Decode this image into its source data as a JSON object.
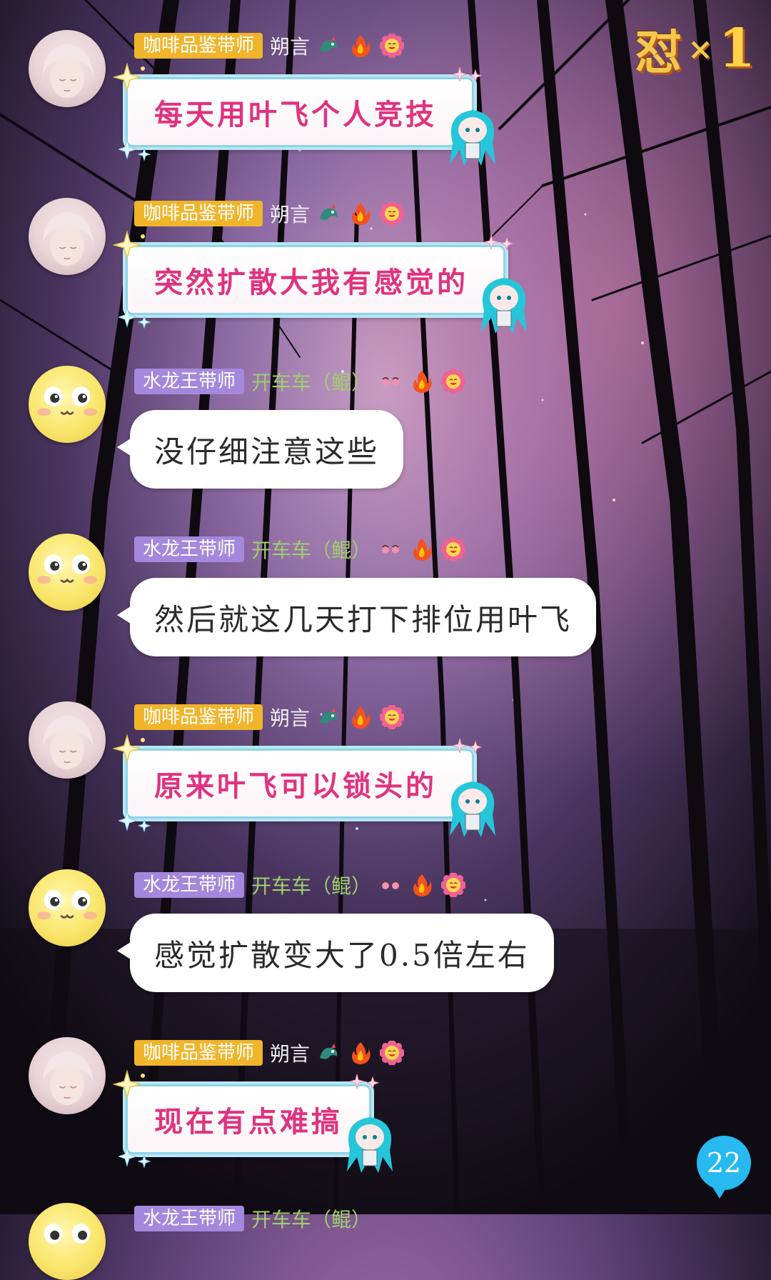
{
  "corner_badge": {
    "char": "怼",
    "times": "×",
    "count": "1"
  },
  "unread_count": "22",
  "messages": [
    {
      "title": "咖啡品鉴带师",
      "nickname": "朔言",
      "text": "每天用叶飞个人竞技",
      "style": "fancy"
    },
    {
      "title": "咖啡品鉴带师",
      "nickname": "朔言",
      "text": "突然扩散大我有感觉的",
      "style": "fancy"
    },
    {
      "title": "水龙王带师",
      "nickname": "开车车（鲲）",
      "text": "没仔细注意这些",
      "style": "plain"
    },
    {
      "title": "水龙王带师",
      "nickname": "开车车（鲲）",
      "text": "然后就这几天打下排位用叶飞",
      "style": "plain"
    },
    {
      "title": "咖啡品鉴带师",
      "nickname": "朔言",
      "text": "原来叶飞可以锁头的",
      "style": "fancy"
    },
    {
      "title": "水龙王带师",
      "nickname": "开车车（鲲）",
      "text": "感觉扩散变大了0.5倍左右",
      "style": "plain"
    },
    {
      "title": "咖啡品鉴带师",
      "nickname": "朔言",
      "text": "现在有点难搞",
      "style": "fancy"
    },
    {
      "title": "水龙王带师",
      "nickname": "开车车（鲲）",
      "text": "",
      "style": "plain"
    }
  ],
  "colors": {
    "title_gold": "#f0b52b",
    "title_purple": "#a488dd",
    "fancy_text": "#e0337e",
    "unread_badge": "#27b9f0"
  },
  "icons": [
    "dragon-icon",
    "fire-icon",
    "flower-smile-icon",
    "blush-eyes-icon"
  ]
}
